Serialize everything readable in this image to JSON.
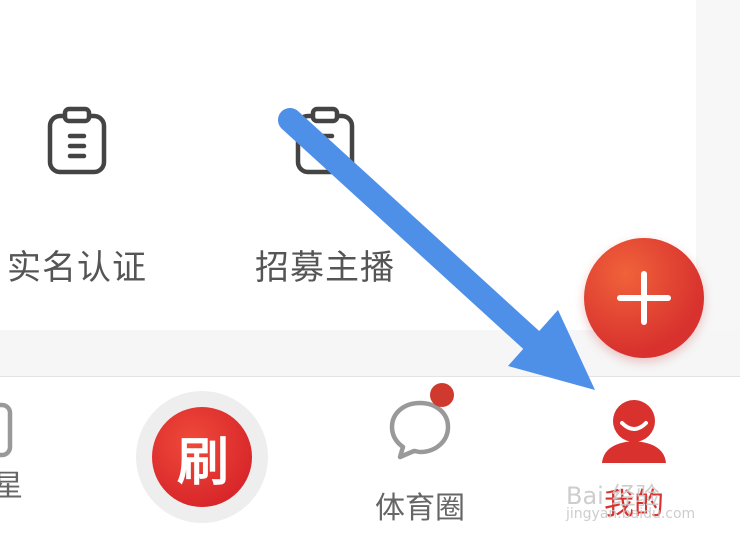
{
  "menu": {
    "items": [
      {
        "label": "实名认证",
        "icon": "clipboard-icon"
      },
      {
        "label": "招募主播",
        "icon": "clipboard-icon"
      }
    ]
  },
  "fab": {
    "icon": "plus-icon"
  },
  "tabbar": {
    "partial_label": "星",
    "center_label": "刷",
    "community_label": "体育圈",
    "mine_label": "我的",
    "accent": "#d8312e",
    "badge_color": "#d03a2e"
  },
  "watermark": {
    "text": "Bai 经验",
    "sub": "jingyan.baidu.com"
  },
  "annotation": {
    "color": "#4e8fe8"
  }
}
